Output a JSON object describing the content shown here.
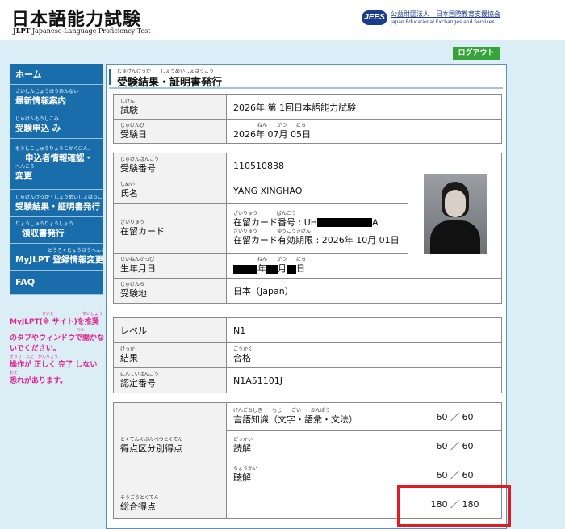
{
  "header": {
    "logo_main": "日本語能力試験",
    "logo_jlpt": "JLPT",
    "logo_en": "Japanese-Language Proficiency Test",
    "org_badge": "JEES",
    "org_name": "公益財団法人　日本国際教育支援協会",
    "org_en": "Japan Educational Exchanges and Services"
  },
  "logout_label": "ログアウト",
  "sidebar": {
    "items": [
      {
        "ruby": "",
        "label": "ホーム"
      },
      {
        "ruby": "さいしんじょうほうあんない",
        "label": "最新情報案内"
      },
      {
        "ruby": "じゅけんもうしこみ",
        "label": "受験申込 み"
      },
      {
        "ruby": "もうしこしゅうりょうこかくにん、",
        "label": "申込者情報確認・",
        "ruby2": "へんこう",
        "label2": "変更"
      },
      {
        "ruby": "じゅけんけっか・しょうめいしょはっこう",
        "label": "受験結果・証明書発行"
      },
      {
        "ruby": "りょうしゅうりょうしょう",
        "label": "領収書発行"
      },
      {
        "ruby": "とうろくじょうほうへんこう",
        "label": "MyJLPT 登録情報変更"
      },
      {
        "ruby": "",
        "label": "FAQ"
      }
    ],
    "note_lines": [
      {
        "ruby": "さいと　　　　　　　すいしょう",
        "text": "MyJLPT(※ サイト)を推奨"
      },
      {
        "ruby": "べつ",
        "text": "のタブやウィンドウで開かな"
      },
      {
        "ruby": "",
        "text": "いでください。"
      },
      {
        "ruby": "そうさ　ただ　かんりょう",
        "text": "操作が 正しく 完了 しない"
      },
      {
        "ruby": "おそ",
        "text": "恐れがあります。"
      }
    ]
  },
  "page": {
    "title_ruby": "じゅけんけっか　　しょうめいしょはっこう",
    "title": "受験結果・証明書発行"
  },
  "exam": {
    "name_ruby": "しけん",
    "name_label": "試験",
    "name_value": "2026年 第 1回日本語能力試験",
    "date_ruby": "じゅけんび",
    "date_label": "受験日",
    "date_value": "2026年 07月 05日",
    "date_value_ruby": "ねん　　がつ　　にち"
  },
  "candidate": {
    "number_ruby": "じゅけんばんごう",
    "number_label": "受験番号",
    "number_value": "110510838",
    "name_ruby": "しめい",
    "name_label": "氏名",
    "name_value": "YANG XINGHAO",
    "card_ruby": "ざいりゅう",
    "card_label": "在留カード",
    "card_line1_ruby": "ざいりゅう　　　　ばんごう",
    "card_line1_prefix": "在留カード番号 : UH",
    "card_line1_suffix": "A",
    "card_line2_ruby": "ざいりゅう　　　　ゆうこうきげん",
    "card_line2": "在留カード有効期限 : 2026年 10月 01日",
    "birth_ruby": "せいねんがっぴ",
    "birth_label": "生年月日",
    "birth_value_ruby": "ねん　　がつ　　にち",
    "birth_year_label": "年",
    "birth_month_label": "月",
    "birth_day_label": "日",
    "place_ruby": "じゅけんち",
    "place_label": "受験地",
    "place_value": "日本（Japan）"
  },
  "result": {
    "level_label": "レベル",
    "level_value": "N1",
    "result_ruby": "けっか",
    "result_label": "結果",
    "result_value_ruby": "ごうかく",
    "result_value": "合格",
    "cert_ruby": "にんていばんごう",
    "cert_label": "認定番号",
    "cert_value": "N1A51101J"
  },
  "scores": {
    "section_ruby": "とくてんくぶんべつとくてん",
    "section_label": "得点区分別得点",
    "rows": [
      {
        "ruby": "げんごちしき　　もじ　　ごい　　ぶんぽう",
        "label": "言語知識（文字・語彙・文法）",
        "score": "60 ／ 60"
      },
      {
        "ruby": "どっかい",
        "label": "読解",
        "score": "60 ／ 60"
      },
      {
        "ruby": "ちょうかい",
        "label": "聴解",
        "score": "60 ／ 60"
      }
    ],
    "total_ruby": "そうごうとくてん",
    "total_label": "総合得点",
    "total_score": "180 ／ 180"
  },
  "colors": {
    "nav_bg": "#1a6dab",
    "logout_bg": "#35a33a",
    "note_color": "#e0238a",
    "highlight_border": "#e01b24"
  }
}
